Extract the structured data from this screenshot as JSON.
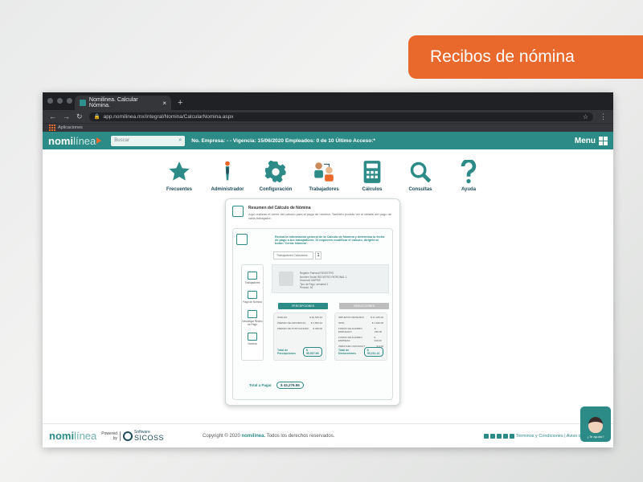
{
  "banner": {
    "title": "Recibos de nómina"
  },
  "browser": {
    "tab_title": "Nomilinea. Calcular Nómina.",
    "url": "app.nomilinea.mx/integral/Nomina/CalcularNomina.aspx",
    "bookmark": "Aplicaciones"
  },
  "app": {
    "logo_a": "nomi",
    "logo_b": "línea",
    "search_placeholder": "Buscar",
    "info_text": "No. Empresa: - - Vigencia: 15/06/2020 Empleados: 0 de 10 Último Acceso:*",
    "menu_label": "Menu",
    "tools": [
      {
        "label": "Frecuentes",
        "icon": "star-icon"
      },
      {
        "label": "Administrador",
        "icon": "administrator-icon"
      },
      {
        "label": "Configuración",
        "icon": "gear-icon"
      },
      {
        "label": "Trabajadores",
        "icon": "workers-icon"
      },
      {
        "label": "Cálculos",
        "icon": "calculator-icon"
      },
      {
        "label": "Consultas",
        "icon": "magnifier-icon"
      },
      {
        "label": "Ayuda",
        "icon": "question-icon"
      }
    ],
    "card": {
      "title": "Resumen del Cálculo de Nómina",
      "description": "Aquí realizas el cierre del cálculo para el pago de nómina. También podrás ver el detalle del pago de cada trabajador.",
      "step_text": "Revisa la información general de la Cálculo de Nómina y determina la fecha de pago a tus trabajadores. Si requieres modificar el cálculo, dirígete al botón 'Cerrar Nómina'.",
      "select_label": "Trabajadores Calculados",
      "select_value": "1",
      "sidebar": [
        "Trabajadores",
        "Pago de Nómina",
        "Descargar Recibo de Pago",
        "Nómina"
      ],
      "employee_lines": [
        "Registro Patronal REGISTRO",
        "Nombre Social REGISTRO PATRONAL 1",
        "Sucursal: MATRIZ",
        "Tipo de Pago: semanal 1",
        "Periodo: 16"
      ],
      "perc_button": "PERCEPCIONES",
      "ded_button": "DEDUCCIONES",
      "perc_rows": [
        {
          "label": "SUELDO",
          "value": "$ 96,525.46"
        },
        {
          "label": "PREMIO DE ASISTENCIA",
          "value": "$ 1,652.22"
        },
        {
          "label": "PREMIO DE PUNTUALIDAD",
          "value": "$ 330.00"
        }
      ],
      "ded_rows": [
        {
          "label": "IMPUESTO RETENIDO",
          "value": "$ 21,425.00"
        },
        {
          "label": "IMSS",
          "value": "$ 1,620.00"
        },
        {
          "label": "FONDO DE AHORRO EMPLEADO",
          "value": "$ 330.00"
        },
        {
          "label": "FONDO DE AHORRO EMPRESA",
          "value": "$ 330.00"
        },
        {
          "label": "PRÉSTAMO INFONAVIT",
          "value": "$ 0.00"
        }
      ],
      "perc_total_label": "Total de Percepciones",
      "perc_total_value": "$ 98,507.68",
      "ded_total_label": "Total de Deducciones",
      "ded_total_value": "$ 55,231.13",
      "total_label": "Total a Pagar",
      "total_value": "$ 43,276.55"
    },
    "footer": {
      "logo_a": "nomi",
      "logo_b": "línea",
      "powered_1": "Powered",
      "powered_2": "by",
      "sicoss_1": "Software",
      "sicoss_2": "SICOSS",
      "copyright_a": "Copyright © 2020",
      "copyright_b": "nomilinea.",
      "copyright_c": "Todos los derechos reservados.",
      "links": "Términos y Condiciones | Aviso de Privacidad"
    },
    "help_label": "¿Te ayudo?"
  },
  "colors": {
    "teal": "#2c8a87",
    "orange": "#e8692b",
    "navy": "#1f4b5a"
  }
}
